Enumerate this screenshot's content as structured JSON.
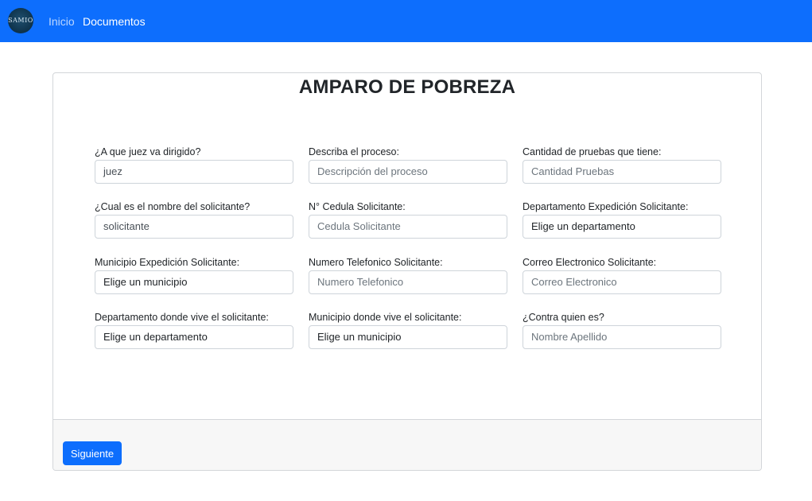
{
  "nav": {
    "brand": "SAMIO",
    "links": [
      {
        "label": "Inicio",
        "active": false
      },
      {
        "label": "Documentos",
        "active": true
      }
    ]
  },
  "form": {
    "title": "AMPARO DE POBREZA",
    "fields": [
      {
        "label": "¿A que juez va dirigido?",
        "value": "juez",
        "kind": "input"
      },
      {
        "label": "Describa el proceso:",
        "value": "Descripción del proceso",
        "kind": "input"
      },
      {
        "label": "Cantidad de pruebas que tiene:",
        "value": "Cantidad Pruebas",
        "kind": "input"
      },
      {
        "label": "¿Cual es el nombre del solicitante?",
        "value": "solicitante",
        "kind": "input"
      },
      {
        "label": "N° Cedula Solicitante:",
        "value": "Cedula Solicitante",
        "kind": "input"
      },
      {
        "label": "Departamento Expedición Solicitante:",
        "value": "Elige un departamento",
        "kind": "select"
      },
      {
        "label": "Municipio Expedición Solicitante:",
        "value": "Elige un municipio",
        "kind": "select"
      },
      {
        "label": "Numero Telefonico Solicitante:",
        "value": "Numero Telefonico",
        "kind": "input"
      },
      {
        "label": "Correo Electronico Solicitante:",
        "value": "Correo Electronico",
        "kind": "input"
      },
      {
        "label": "Departamento donde vive el solicitante:",
        "value": "Elige un departamento",
        "kind": "select"
      },
      {
        "label": "Municipio donde vive el solicitante:",
        "value": "Elige un municipio",
        "kind": "select"
      },
      {
        "label": "¿Contra quien es?",
        "value": "Nombre Apellido",
        "kind": "input"
      }
    ],
    "next_button": "Siguiente"
  },
  "colors": {
    "primary": "#0d6efd",
    "footer_bg": "#f7f7f7",
    "placeholder": "#6c757d"
  }
}
